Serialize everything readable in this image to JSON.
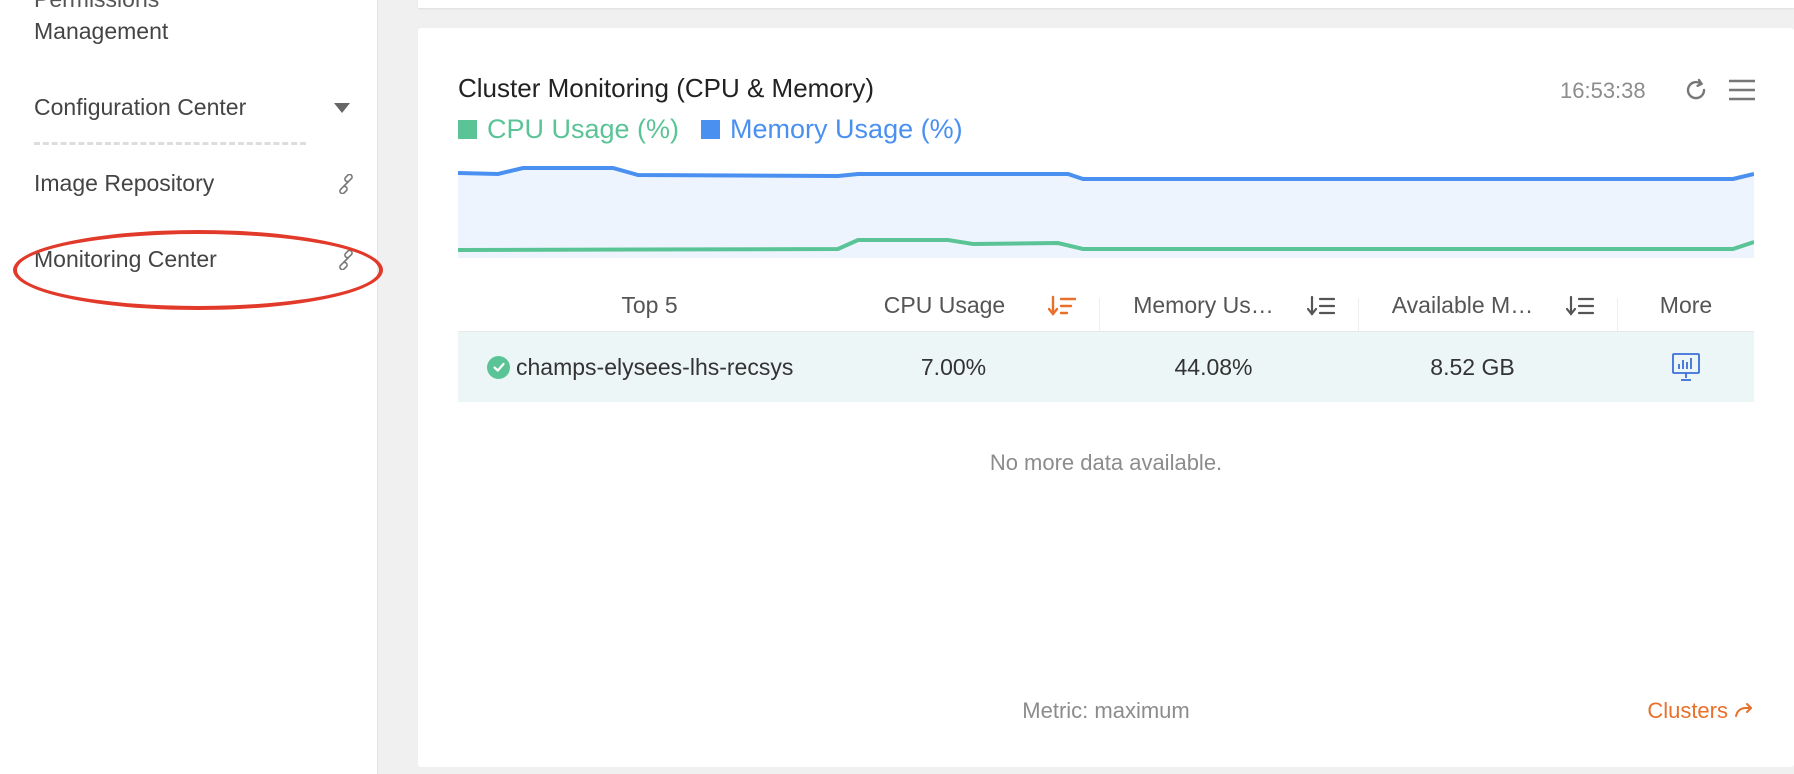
{
  "sidebar": {
    "permissions_label_line1": "Permissions",
    "permissions_label_line2": "Management",
    "items": [
      {
        "label": "Configuration Center",
        "icon": "chevron-down-icon"
      },
      {
        "label": "Image Repository",
        "icon": "link-icon"
      },
      {
        "label": "Monitoring Center",
        "icon": "link-icon"
      }
    ]
  },
  "card": {
    "title": "Cluster Monitoring (CPU & Memory)",
    "time": "16:53:38",
    "legend": [
      {
        "label": "CPU Usage (%)",
        "color": "#5bc497"
      },
      {
        "label": "Memory Usage (%)",
        "color": "#4a90f0"
      }
    ],
    "table": {
      "headers": {
        "name": "Top 5",
        "cpu": "CPU Usage",
        "memory": "Memory Us…",
        "available": "Available M…",
        "more": "More"
      },
      "rows": [
        {
          "name": "champs-elysees-lhs-recsys",
          "cpu": "7.00%",
          "memory": "44.08%",
          "available": "8.52 GB",
          "status": "healthy"
        }
      ]
    },
    "empty_message": "No more data available.",
    "metric_label": "Metric: maximum",
    "clusters_link": "Clusters"
  },
  "colors": {
    "accent_orange": "#e8702a",
    "cpu_green": "#5bc497",
    "memory_blue": "#4a90f0",
    "highlight_red": "#e23a2a"
  }
}
